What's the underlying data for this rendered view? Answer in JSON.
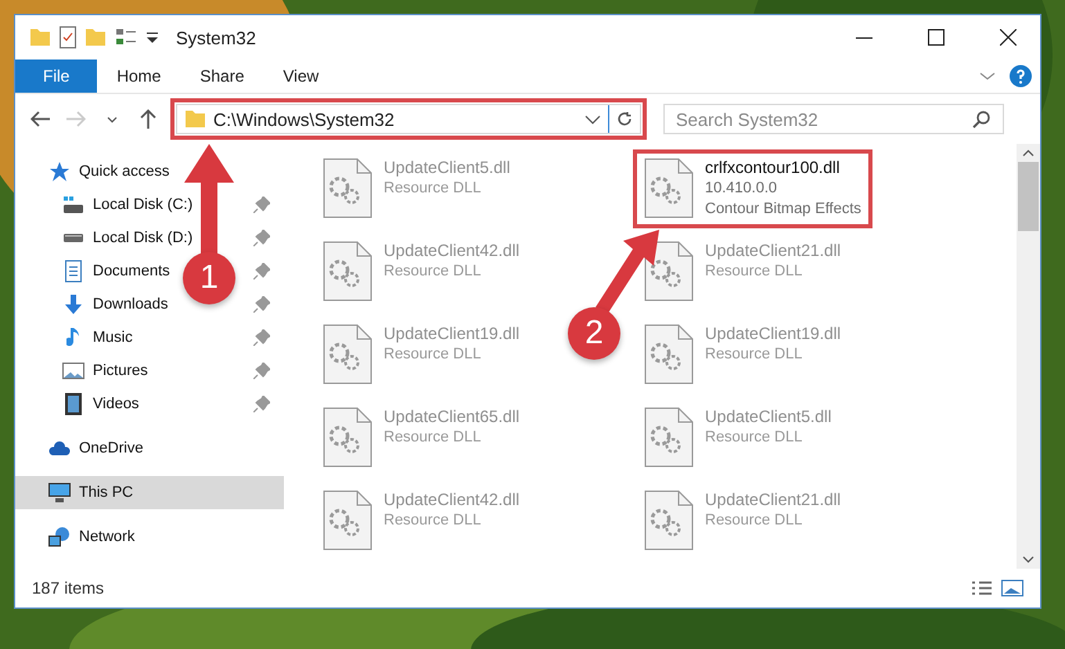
{
  "window": {
    "title": "System32"
  },
  "ribbon_tabs": [
    {
      "label": "File",
      "kind": "file"
    },
    {
      "label": "Home",
      "kind": "tab"
    },
    {
      "label": "Share",
      "kind": "tab"
    },
    {
      "label": "View",
      "kind": "tab"
    }
  ],
  "address_bar": {
    "path": "C:\\Windows\\System32",
    "forward_disabled": true,
    "highlighted": true
  },
  "search": {
    "placeholder": "Search System32"
  },
  "sidebar": {
    "items": [
      {
        "label": "Quick access",
        "kind": "star",
        "selected": false,
        "children": [
          {
            "label": "Local Disk (C:)",
            "kind": "system-drive",
            "pinned": true,
            "selected": false
          },
          {
            "label": "Local Disk (D:)",
            "kind": "drive",
            "pinned": true,
            "selected": false
          },
          {
            "label": "Documents",
            "kind": "documents",
            "pinned": true,
            "selected": false
          },
          {
            "label": "Downloads",
            "kind": "downloads",
            "pinned": true,
            "selected": false
          },
          {
            "label": "Music",
            "kind": "music",
            "pinned": true,
            "selected": false
          },
          {
            "label": "Pictures",
            "kind": "pictures",
            "pinned": true,
            "selected": false
          },
          {
            "label": "Videos",
            "kind": "videos",
            "pinned": true,
            "selected": false
          }
        ]
      },
      {
        "label": "OneDrive",
        "kind": "cloud",
        "selected": false
      },
      {
        "label": "This PC",
        "kind": "computer",
        "selected": true
      },
      {
        "label": "Network",
        "kind": "network",
        "selected": false
      }
    ]
  },
  "files": [
    {
      "name": "UpdateClient5.dll",
      "lines": [
        "Resource DLL"
      ],
      "dimmed": true,
      "highlighted": false
    },
    {
      "name": "crlfxcontour100.dll",
      "lines": [
        "10.410.0.0",
        "Contour Bitmap Effects"
      ],
      "dimmed": false,
      "highlighted": true
    },
    {
      "name": "UpdateClient42.dll",
      "lines": [
        "Resource DLL"
      ],
      "dimmed": true,
      "highlighted": false
    },
    {
      "name": "UpdateClient21.dll",
      "lines": [
        "Resource DLL"
      ],
      "dimmed": true,
      "highlighted": false
    },
    {
      "name": "UpdateClient19.dll",
      "lines": [
        "Resource DLL"
      ],
      "dimmed": true,
      "highlighted": false
    },
    {
      "name": "UpdateClient19.dll",
      "lines": [
        "Resource DLL"
      ],
      "dimmed": true,
      "highlighted": false
    },
    {
      "name": "UpdateClient65.dll",
      "lines": [
        "Resource DLL"
      ],
      "dimmed": true,
      "highlighted": false
    },
    {
      "name": "UpdateClient5.dll",
      "lines": [
        "Resource DLL"
      ],
      "dimmed": true,
      "highlighted": false
    },
    {
      "name": "UpdateClient42.dll",
      "lines": [
        "Resource DLL"
      ],
      "dimmed": true,
      "highlighted": false
    },
    {
      "name": "UpdateClient21.dll",
      "lines": [
        "Resource DLL"
      ],
      "dimmed": true,
      "highlighted": false
    }
  ],
  "status_bar": {
    "item_count": "187 items"
  },
  "annotations": [
    {
      "label": "1"
    },
    {
      "label": "2"
    }
  ]
}
